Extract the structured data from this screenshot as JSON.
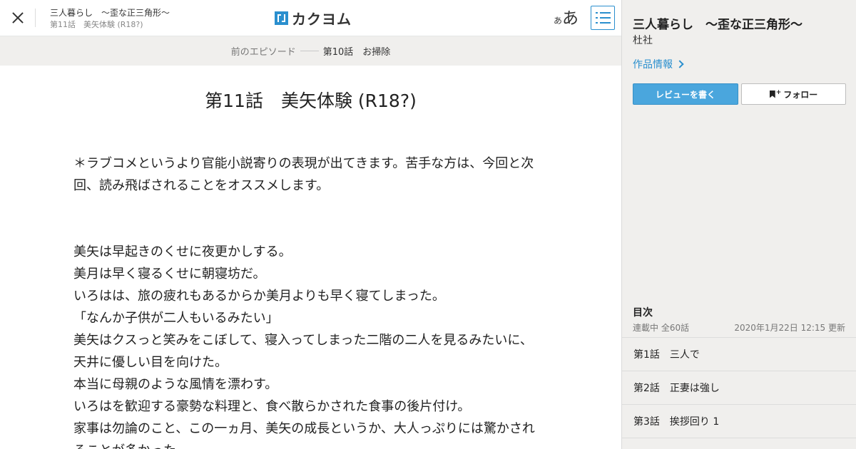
{
  "header": {
    "work_title": "三人暮らし　～歪な正三角形～",
    "episode_subtitle": "第11話　美矢体験 (R18?)",
    "logo_text": "カクヨム",
    "font_size_small": "あ",
    "font_size_large": "あ"
  },
  "prev_nav": {
    "label": "前のエピソード",
    "title": "第10話　お掃除"
  },
  "episode": {
    "title": "第11話　美矢体験 (R18?)",
    "paragraphs": [
      "＊ラブコメというより官能小説寄りの表現が出てきます。苦手な方は、今回と次",
      "回、読み飛ばされることをオススメします。",
      "",
      "",
      "美矢は早起きのくせに夜更かしする。",
      "美月は早く寝るくせに朝寝坊だ。",
      "いろはは、旅の疲れもあるからか美月よりも早く寝てしまった。",
      "「なんか子供が二人もいるみたい」",
      "美矢はクスっと笑みをこぼして、寝入ってしまった二階の二人を見るみたいに、",
      "天井に優しい目を向けた。",
      "本当に母親のような風情を漂わす。",
      "いろはを歓迎する豪勢な料理と、食べ散らかされた食事の後片付け。",
      "家事は勿論のこと、この一ヵ月、美矢の成長というか、大人っぷりには驚かされ",
      "ることが多かった。"
    ]
  },
  "sidebar": {
    "work_title": "三人暮らし　～歪な正三角形～",
    "author": "杜社",
    "info_link": "作品情報",
    "review_button": "レビューを書く",
    "follow_button": "フォロー",
    "follow_plus": "+",
    "toc_heading": "目次",
    "toc_status": "連載中 全60話",
    "toc_updated": "2020年1月22日 12:15 更新",
    "toc_items": [
      "第1話　三人で",
      "第2話　正妻は強し",
      "第3話　挨拶回り 1"
    ]
  },
  "colors": {
    "accent": "#2a8fce",
    "review_button_bg": "#4aa6dd",
    "sidebar_bg": "#f0efed",
    "prevbar_bg": "#f0efed"
  },
  "icons": [
    "close-icon",
    "kakuyomu-logo-icon",
    "font-size-icon",
    "toc-list-icon",
    "chevron-right-icon",
    "bookmark-icon"
  ]
}
